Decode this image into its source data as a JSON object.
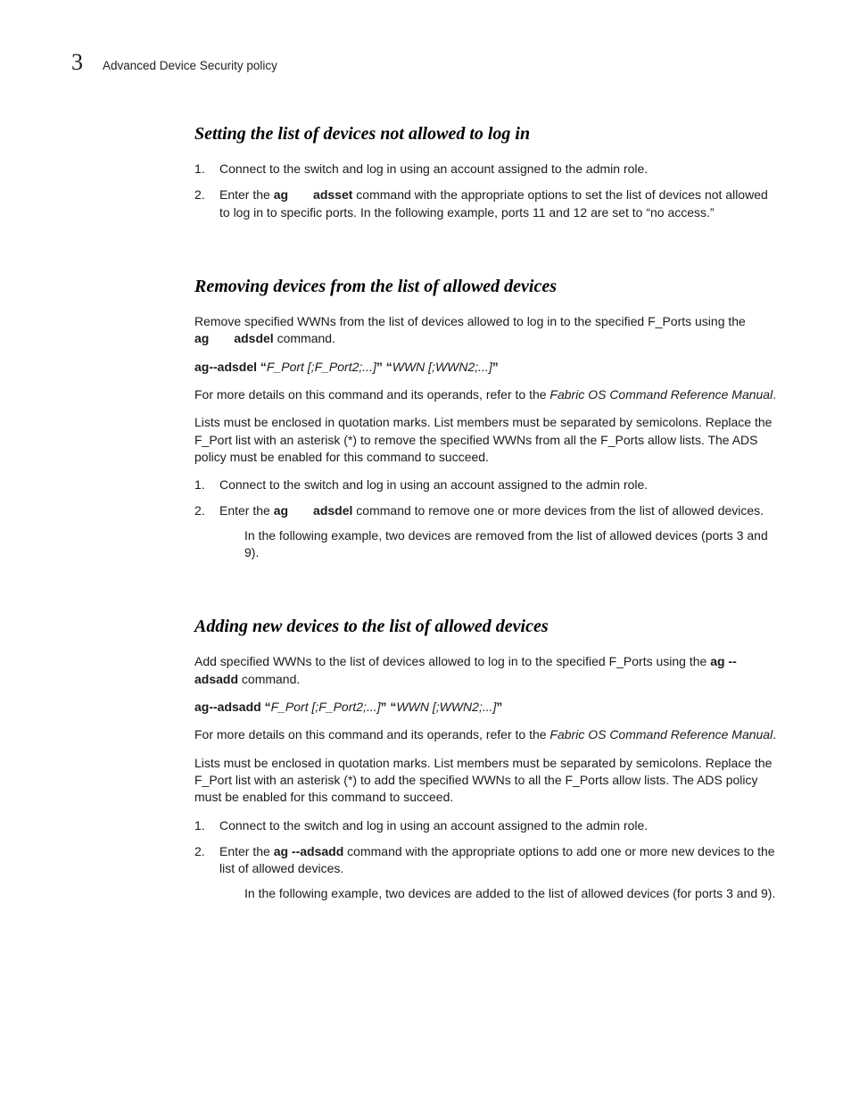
{
  "header": {
    "chapter_number": "3",
    "title": "Advanced Device Security policy"
  },
  "sections": [
    {
      "heading": "Setting the list of devices not allowed to log in",
      "steps": [
        {
          "text": "Connect to the switch and log in using an account assigned to the admin role."
        },
        {
          "pre": "Enter the ",
          "cmd_a": "ag",
          "gap": "  ",
          "cmd_b": "adsset",
          "post": " command with the appropriate options to set the list of devices not allowed to log in to specific ports. In the following example, ports 11 and 12 are set to “no access.”"
        }
      ]
    },
    {
      "heading": "Removing devices from the list of allowed devices",
      "intro1_pre": "Remove specified WWNs from the list of devices allowed to log in to the specified F_Ports using the ",
      "intro1_cmd_a": "ag",
      "intro1_gap": "  ",
      "intro1_cmd_b": "adsdel",
      "intro1_post": " command.",
      "cmdline_bold1": "ag--adsdel “",
      "cmdline_ital1": "F_Port [;F_Port2;...]",
      "cmdline_bold2": "” “",
      "cmdline_ital2": "WWN [;WWN2;...]",
      "cmdline_bold3": "”",
      "ref_pre": "For more details on this command and its operands, refer to the ",
      "ref_ital": "Fabric OS Command Reference Manual",
      "ref_post": ".",
      "notes": "Lists must be enclosed in quotation marks. List members must be separated by semicolons. Replace the F_Port list with an asterisk (*) to remove the specified WWNs from all the F_Ports allow lists. The ADS policy must be enabled for this command to succeed.",
      "steps": [
        {
          "text": "Connect to the switch and log in using an account assigned to the admin role."
        },
        {
          "pre": "Enter the ",
          "cmd_a": "ag",
          "gap": "  ",
          "cmd_b": "adsdel",
          "post": " command to remove one or more devices from the list of allowed devices.",
          "sub": "In the following example, two devices are removed from the list of allowed devices (ports 3 and 9)."
        }
      ]
    },
    {
      "heading": "Adding new devices to the list of allowed devices",
      "intro1_pre": "Add specified WWNs to the list of devices allowed to log in to the specified F_Ports using the ",
      "intro1_cmd_a": "ag --adsadd",
      "intro1_post": " command.",
      "cmdline_bold1": "ag--adsadd “",
      "cmdline_ital1": "F_Port [;F_Port2;...]",
      "cmdline_bold2": "” “",
      "cmdline_ital2": "WWN [;WWN2;...]",
      "cmdline_bold3": "”",
      "ref_pre": "For more details on this command and its operands, refer to the ",
      "ref_ital": "Fabric OS Command Reference Manual",
      "ref_post": ".",
      "notes": "Lists must be enclosed in quotation marks. List members must be separated by semicolons. Replace the F_Port list with an asterisk (*) to add the specified WWNs to all the F_Ports allow lists. The ADS policy must be enabled for this command to succeed.",
      "steps": [
        {
          "text": "Connect to the switch and log in using an account assigned to the admin role."
        },
        {
          "pre": "Enter the ",
          "cmd_a": "ag --adsadd",
          "post": " command with the appropriate options to add one or more new devices to the list of allowed devices.",
          "sub": "In the following example, two devices are added to the list of allowed devices (for ports 3 and 9)."
        }
      ]
    }
  ]
}
